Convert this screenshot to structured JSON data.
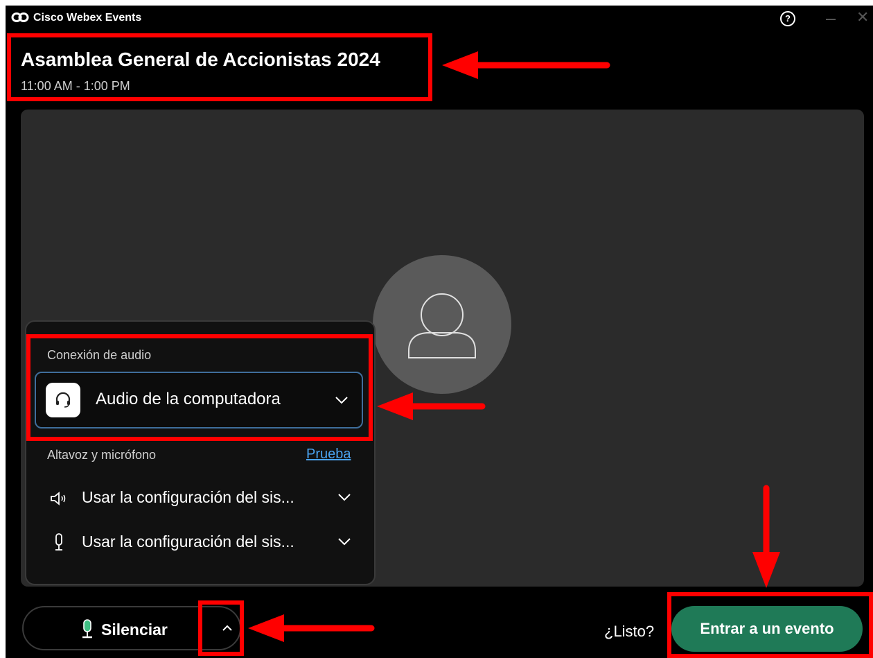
{
  "window": {
    "app_name": "Cisco Webex Events",
    "help_icon": "?",
    "minimize_icon": "minimize-icon",
    "close_icon": "close-icon"
  },
  "event": {
    "title": "Asamblea General de Accionistas 2024",
    "time": "11:00 AM - 1:00 PM"
  },
  "audio_panel": {
    "connection_label": "Conexión de audio",
    "connection_value": "Audio de la computadora",
    "speaker_mic_label": "Altavoz y micrófono",
    "test_link": "Prueba",
    "speaker_value": "Usar la configuración del sis...",
    "mic_value": "Usar la configuración del sis..."
  },
  "footer": {
    "mute_label": "Silenciar",
    "ready_text": "¿Listo?",
    "join_label": "Entrar a un evento"
  },
  "colors": {
    "background": "#000000",
    "preview": "#2b2b2b",
    "join_button": "#1f7a57",
    "link": "#4aa3f0",
    "annotation": "#ff0000"
  }
}
